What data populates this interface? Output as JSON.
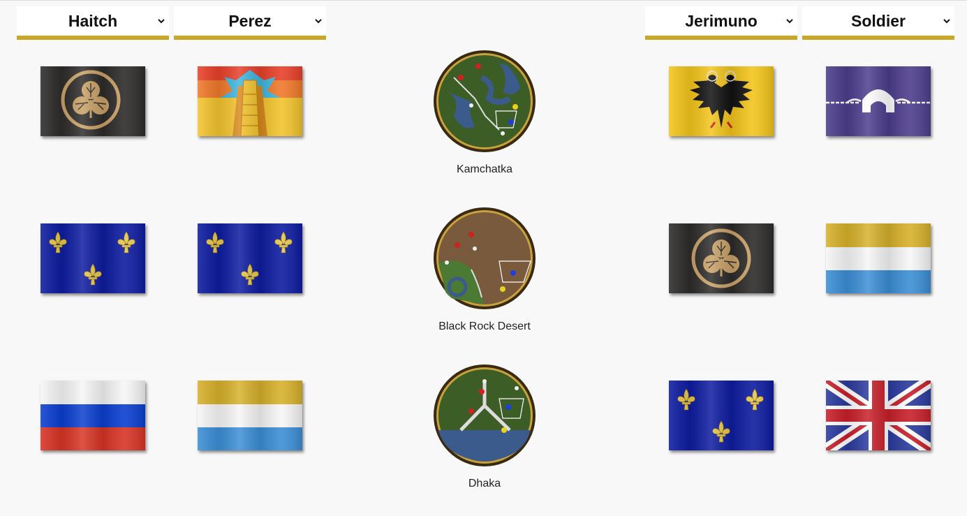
{
  "players": [
    {
      "name": "Haitch"
    },
    {
      "name": "Perez"
    },
    {
      "name": "Jerimuno"
    },
    {
      "name": "Soldier"
    }
  ],
  "maps": [
    {
      "name": "Kamchatka"
    },
    {
      "name": "Black Rock Desert"
    },
    {
      "name": "Dhaka"
    }
  ],
  "flags": {
    "haitch": [
      "japan-mon",
      "fleur-de-lis-blue",
      "russia"
    ],
    "perez": [
      "aztec-sun-pyramid",
      "fleur-de-lis-blue",
      "gold-white-blue"
    ],
    "jerimuno": [
      "holy-roman-eagle",
      "japan-mon",
      "fleur-de-lis-blue"
    ],
    "soldier": [
      "purple-igloo",
      "gold-white-blue",
      "union-jack"
    ]
  },
  "icons": {
    "dropdown": "chevron-down-icon"
  },
  "colors": {
    "accent": "#c9a826",
    "background": "#f8f8f8"
  }
}
